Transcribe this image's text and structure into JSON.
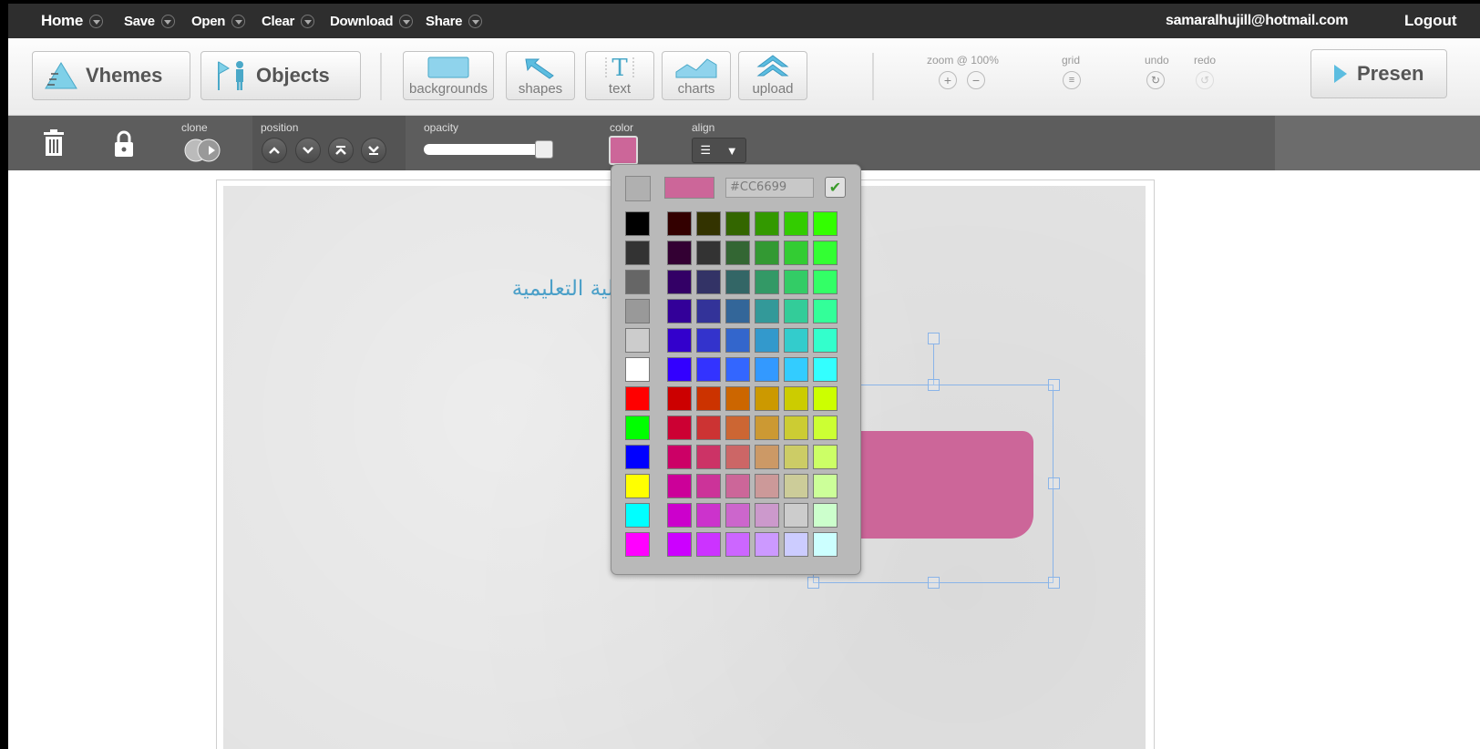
{
  "topbar": {
    "menu": [
      {
        "label": "Home"
      },
      {
        "label": "Save"
      },
      {
        "label": "Open"
      },
      {
        "label": "Clear"
      },
      {
        "label": "Download"
      },
      {
        "label": "Share"
      }
    ],
    "user_email": "samaralhujill@hotmail.com",
    "logout_label": "Logout"
  },
  "toolbar": {
    "vhemes_label": "Vhemes",
    "objects_label": "Objects",
    "tools": [
      {
        "label": "backgrounds",
        "icon": "backgrounds-icon"
      },
      {
        "label": "shapes",
        "icon": "shapes-icon"
      },
      {
        "label": "text",
        "icon": "text-icon"
      },
      {
        "label": "charts",
        "icon": "charts-icon"
      },
      {
        "label": "upload",
        "icon": "upload-icon"
      }
    ],
    "zoom_label": "zoom @ 100%",
    "grid_label": "grid",
    "undo_label": "undo",
    "redo_label": "redo",
    "present_label": "Presen"
  },
  "properties": {
    "clone_label": "clone",
    "position_label": "position",
    "opacity_label": "opacity",
    "opacity_value": 1.0,
    "color_label": "color",
    "align_label": "align",
    "current_color": "#CC6699"
  },
  "canvas": {
    "title_text": "مجالات التكنولوجيا في العملية التعليمية",
    "shape_color": "#CC6699"
  },
  "color_picker": {
    "hex_value": "#CC6699",
    "left_column": [
      "#000000",
      "#333333",
      "#666666",
      "#999999",
      "#cccccc",
      "#ffffff",
      "#ff0000",
      "#00ff00",
      "#0000ff",
      "#ffff00",
      "#00ffff",
      "#ff00ff"
    ],
    "grid": [
      [
        "#330000",
        "#333300",
        "#336600",
        "#339900",
        "#33cc00",
        "#33ff00"
      ],
      [
        "#330033",
        "#333333",
        "#336633",
        "#339933",
        "#33cc33",
        "#33ff33"
      ],
      [
        "#330066",
        "#333366",
        "#336666",
        "#339966",
        "#33cc66",
        "#33ff66"
      ],
      [
        "#330099",
        "#333399",
        "#336699",
        "#339999",
        "#33cc99",
        "#33ff99"
      ],
      [
        "#3300cc",
        "#3333cc",
        "#3366cc",
        "#3399cc",
        "#33cccc",
        "#33ffcc"
      ],
      [
        "#3300ff",
        "#3333ff",
        "#3366ff",
        "#3399ff",
        "#33ccff",
        "#33ffff"
      ],
      [
        "#cc0000",
        "#cc3300",
        "#cc6600",
        "#cc9900",
        "#cccc00",
        "#ccff00"
      ],
      [
        "#cc0033",
        "#cc3333",
        "#cc6633",
        "#cc9933",
        "#cccc33",
        "#ccff33"
      ],
      [
        "#cc0066",
        "#cc3366",
        "#cc6666",
        "#cc9966",
        "#cccc66",
        "#ccff66"
      ],
      [
        "#cc0099",
        "#cc3399",
        "#cc6699",
        "#cc9999",
        "#cccc99",
        "#ccff99"
      ],
      [
        "#cc00cc",
        "#cc33cc",
        "#cc66cc",
        "#cc99cc",
        "#cccccc",
        "#ccffcc"
      ],
      [
        "#cc00ff",
        "#cc33ff",
        "#cc66ff",
        "#cc99ff",
        "#ccccff",
        "#ccffff"
      ]
    ]
  }
}
